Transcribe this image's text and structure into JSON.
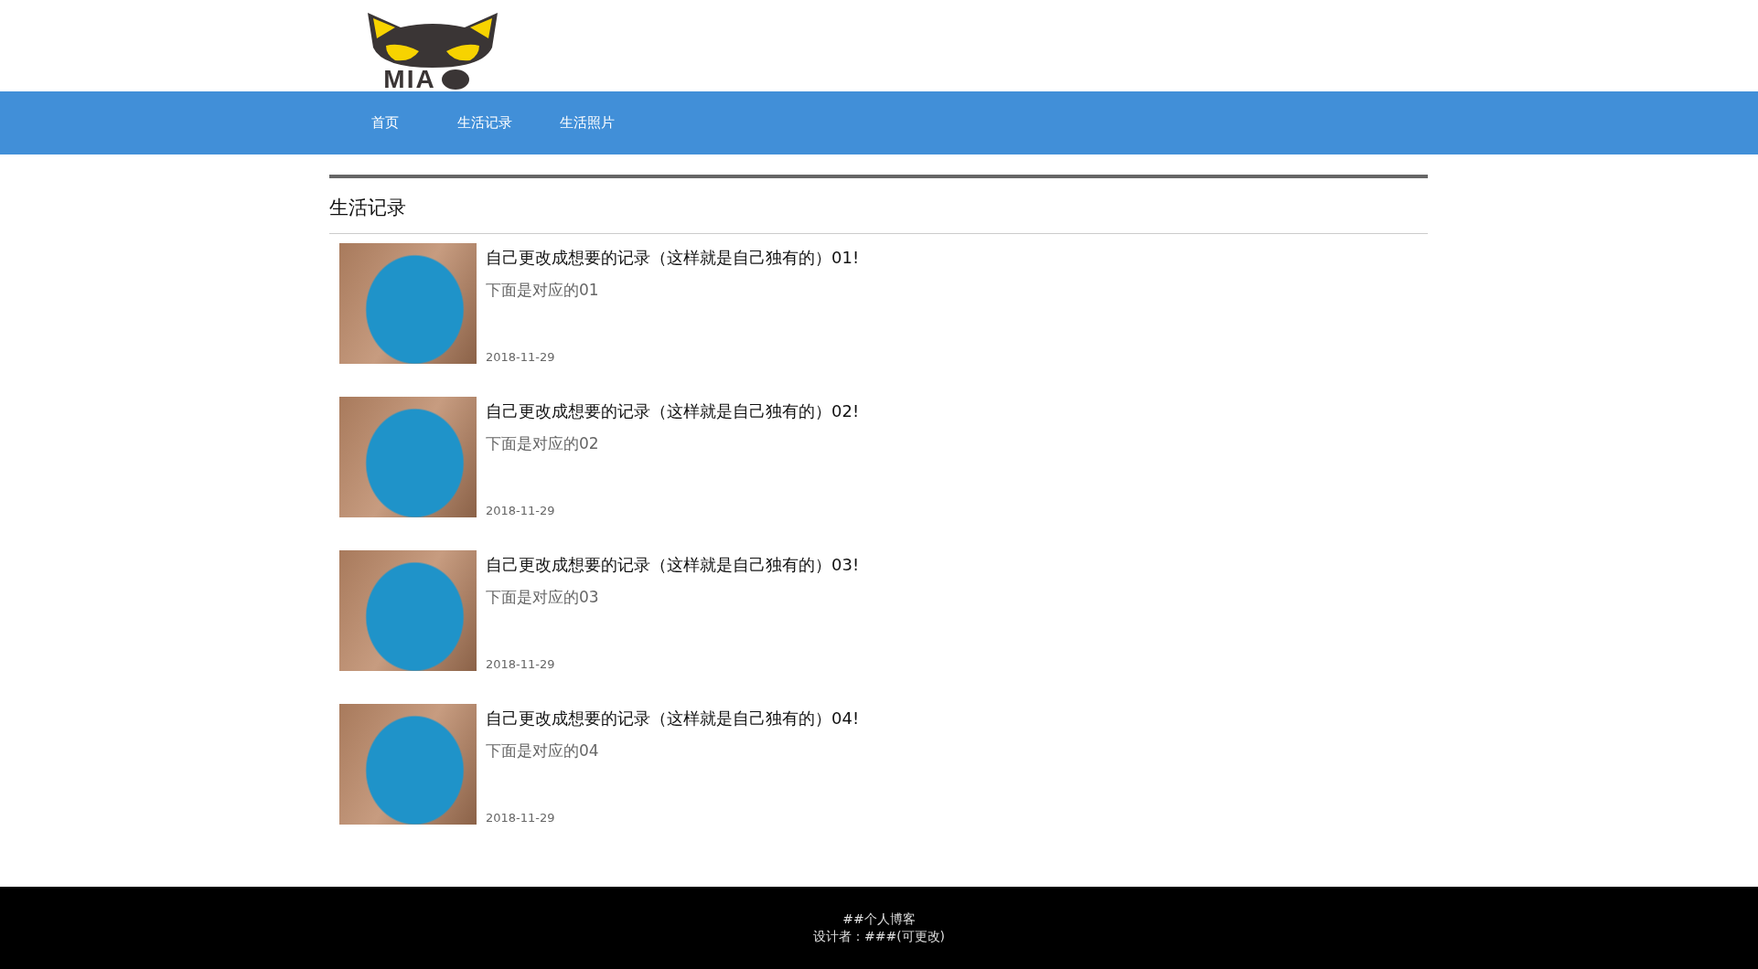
{
  "logo": {
    "text": "MIA"
  },
  "nav": [
    {
      "label": "首页"
    },
    {
      "label": "生活记录"
    },
    {
      "label": "生活照片"
    }
  ],
  "section": {
    "title": "生活记录"
  },
  "posts": [
    {
      "title": "自己更改成想要的记录（这样就是自己独有的）01!",
      "summary": "下面是对应的01",
      "date": "2018-11-29"
    },
    {
      "title": "自己更改成想要的记录（这样就是自己独有的）02!",
      "summary": "下面是对应的02",
      "date": "2018-11-29"
    },
    {
      "title": "自己更改成想要的记录（这样就是自己独有的）03!",
      "summary": "下面是对应的03",
      "date": "2018-11-29"
    },
    {
      "title": "自己更改成想要的记录（这样就是自己独有的）04!",
      "summary": "下面是对应的04",
      "date": "2018-11-29"
    }
  ],
  "footer": {
    "lines": [
      "##个人博客",
      "设计者：###(可更改)"
    ]
  }
}
